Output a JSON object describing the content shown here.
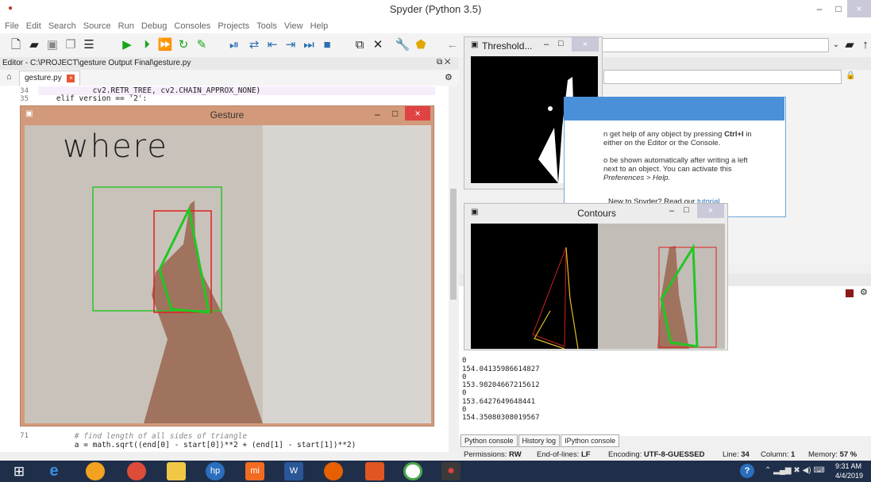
{
  "app": {
    "title": "Spyder (Python 3.5)",
    "app_icon": "spyder-icon"
  },
  "window_controls": [
    "–",
    "□",
    "×"
  ],
  "menu": [
    "File",
    "Edit",
    "Search",
    "Source",
    "Run",
    "Debug",
    "Consoles",
    "Projects",
    "Tools",
    "View",
    "Help"
  ],
  "editor": {
    "path": "Editor - C:\\PROJECT\\gesture Output Final\\gesture.py",
    "tab": "gesture.py",
    "lines_top": [
      {
        "num": "34",
        "text": "            cv2.RETR_TREE, cv2.CHAIN_APPROX_NONE)"
      },
      {
        "num": "35",
        "text": "    elif version == '2':"
      }
    ],
    "lines_bottom": [
      {
        "num": "71",
        "text": "        # find length of all sides of triangle"
      },
      {
        "num": "",
        "text": "        a = math.sqrt((end[0] - start[0])**2 + (end[1] - start[1])**2)"
      }
    ]
  },
  "gesture_window": {
    "title": "Gesture",
    "overlay_word": "where"
  },
  "threshold_window": {
    "title": "Threshold..."
  },
  "contours_window": {
    "title": "Contours"
  },
  "help_pane": {
    "line1": "n get help of any object by pressing",
    "key1": "Ctrl+I",
    "line1b": "in",
    "line2": "either on the Editor or the Console.",
    "line3": "o be shown automatically after writing a left",
    "line4": "next to an object. You can activate this",
    "line5": "Preferences > Help.",
    "footer": "New to Spyder? Read our",
    "footer_link": "tutorial"
  },
  "console": {
    "output": [
      "0",
      "154.04135986614827",
      "0",
      "153.98204667215612",
      "0",
      "153.6427649648441",
      "0",
      "154.35080308019567"
    ],
    "tabs": [
      "Python console",
      "History log",
      "IPython console"
    ]
  },
  "status": {
    "permissions_label": "Permissions:",
    "permissions": "RW",
    "eol_label": "End-of-lines:",
    "eol": "LF",
    "encoding_label": "Encoding:",
    "encoding": "UTF-8-GUESSED",
    "line_label": "Line:",
    "line": "34",
    "column_label": "Column:",
    "column": "1",
    "memory_label": "Memory:",
    "memory": "57 %"
  },
  "taskbar": {
    "time": "9:31 AM",
    "date": "4/4/2019"
  },
  "colors": {
    "accent": "#4a90d9",
    "editor_bg": "#ffffff",
    "taskbar": "#1f2f4a",
    "gesture_frame": "#d29a7a"
  }
}
